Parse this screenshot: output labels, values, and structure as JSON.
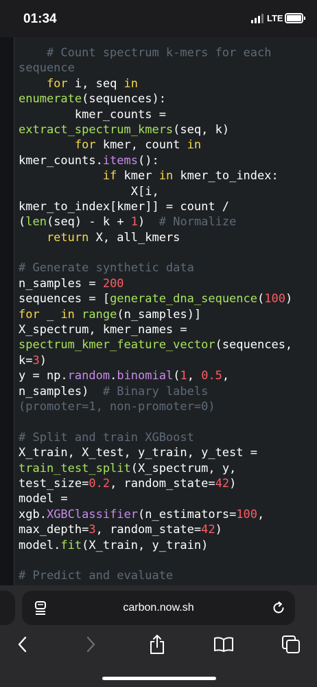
{
  "status_bar": {
    "time": "01:34",
    "network": "LTE"
  },
  "code_lines": [
    [
      [
        "comment",
        "    # Count spectrum k-mers for each"
      ]
    ],
    [
      [
        "comment",
        "sequence"
      ]
    ],
    [
      [
        "keyword",
        "    for"
      ],
      [
        "name",
        " i, seq "
      ],
      [
        "keyword",
        "in"
      ]
    ],
    [
      [
        "builtin",
        "enumerate"
      ],
      [
        "name",
        "(sequences):"
      ]
    ],
    [
      [
        "name",
        "        kmer_counts "
      ],
      [
        "name",
        "="
      ]
    ],
    [
      [
        "func",
        "extract_spectrum_kmers"
      ],
      [
        "name",
        "(seq, k)"
      ]
    ],
    [
      [
        "keyword",
        "        for"
      ],
      [
        "name",
        " kmer, count "
      ],
      [
        "keyword",
        "in"
      ]
    ],
    [
      [
        "name",
        "kmer_counts."
      ],
      [
        "attr",
        "items"
      ],
      [
        "name",
        "():"
      ]
    ],
    [
      [
        "keyword",
        "            if"
      ],
      [
        "name",
        " kmer "
      ],
      [
        "keyword",
        "in"
      ],
      [
        "name",
        " kmer_to_index:"
      ]
    ],
    [
      [
        "name",
        "                X[i,"
      ]
    ],
    [
      [
        "name",
        "kmer_to_index[kmer]] = count /"
      ]
    ],
    [
      [
        "name",
        "("
      ],
      [
        "builtin",
        "len"
      ],
      [
        "name",
        "(seq) - k + "
      ],
      [
        "num",
        "1"
      ],
      [
        "name",
        ")  "
      ],
      [
        "comment",
        "# Normalize"
      ]
    ],
    [
      [
        "keyword",
        "    return"
      ],
      [
        "name",
        " X, all_kmers"
      ]
    ],
    [
      [
        "name",
        ""
      ]
    ],
    [
      [
        "comment",
        "# Generate synthetic data"
      ]
    ],
    [
      [
        "name",
        "n_samples = "
      ],
      [
        "num",
        "200"
      ]
    ],
    [
      [
        "name",
        "sequences = ["
      ],
      [
        "func",
        "generate_dna_sequence"
      ],
      [
        "name",
        "("
      ],
      [
        "num",
        "100"
      ],
      [
        "name",
        ")"
      ]
    ],
    [
      [
        "keyword",
        "for"
      ],
      [
        "name",
        " _ "
      ],
      [
        "keyword",
        "in"
      ],
      [
        "name",
        " "
      ],
      [
        "builtin",
        "range"
      ],
      [
        "name",
        "(n_samples)]"
      ]
    ],
    [
      [
        "name",
        "X_spectrum, kmer_names ="
      ]
    ],
    [
      [
        "func",
        "spectrum_kmer_feature_vector"
      ],
      [
        "name",
        "(sequences,"
      ]
    ],
    [
      [
        "name",
        "k="
      ],
      [
        "num",
        "3"
      ],
      [
        "name",
        ")"
      ]
    ],
    [
      [
        "name",
        "y = np."
      ],
      [
        "attr",
        "random"
      ],
      [
        "name",
        "."
      ],
      [
        "attr",
        "binomial"
      ],
      [
        "name",
        "("
      ],
      [
        "num",
        "1"
      ],
      [
        "name",
        ", "
      ],
      [
        "num",
        "0.5"
      ],
      [
        "name",
        ","
      ]
    ],
    [
      [
        "name",
        "n_samples)  "
      ],
      [
        "comment",
        "# Binary labels"
      ]
    ],
    [
      [
        "comment",
        "(promoter=1, non-promoter=0)"
      ]
    ],
    [
      [
        "name",
        ""
      ]
    ],
    [
      [
        "comment",
        "# Split and train XGBoost"
      ]
    ],
    [
      [
        "name",
        "X_train, X_test, y_train, y_test ="
      ]
    ],
    [
      [
        "func",
        "train_test_split"
      ],
      [
        "name",
        "(X_spectrum, y,"
      ]
    ],
    [
      [
        "name",
        "test_size="
      ],
      [
        "num",
        "0.2"
      ],
      [
        "name",
        ", random_state="
      ],
      [
        "num",
        "42"
      ],
      [
        "name",
        ")"
      ]
    ],
    [
      [
        "name",
        "model ="
      ]
    ],
    [
      [
        "name",
        "xgb."
      ],
      [
        "attr",
        "XGBClassifier"
      ],
      [
        "name",
        "(n_estimators="
      ],
      [
        "num",
        "100"
      ],
      [
        "name",
        ","
      ]
    ],
    [
      [
        "name",
        "max_depth="
      ],
      [
        "num",
        "3"
      ],
      [
        "name",
        ", random_state="
      ],
      [
        "num",
        "42"
      ],
      [
        "name",
        ")"
      ]
    ],
    [
      [
        "name",
        "model."
      ],
      [
        "func",
        "fit"
      ],
      [
        "name",
        "(X_train, y_train)"
      ]
    ],
    [
      [
        "name",
        ""
      ]
    ],
    [
      [
        "comment",
        "# Predict and evaluate"
      ]
    ]
  ],
  "browser": {
    "url": "carbon.now.sh"
  },
  "icons": {
    "reader": "reader-mode-icon",
    "reload": "reload-icon",
    "back": "back-chevron-icon",
    "forward": "forward-chevron-icon",
    "share": "share-icon",
    "bookmarks": "bookmarks-icon",
    "tabs": "tabs-icon"
  }
}
